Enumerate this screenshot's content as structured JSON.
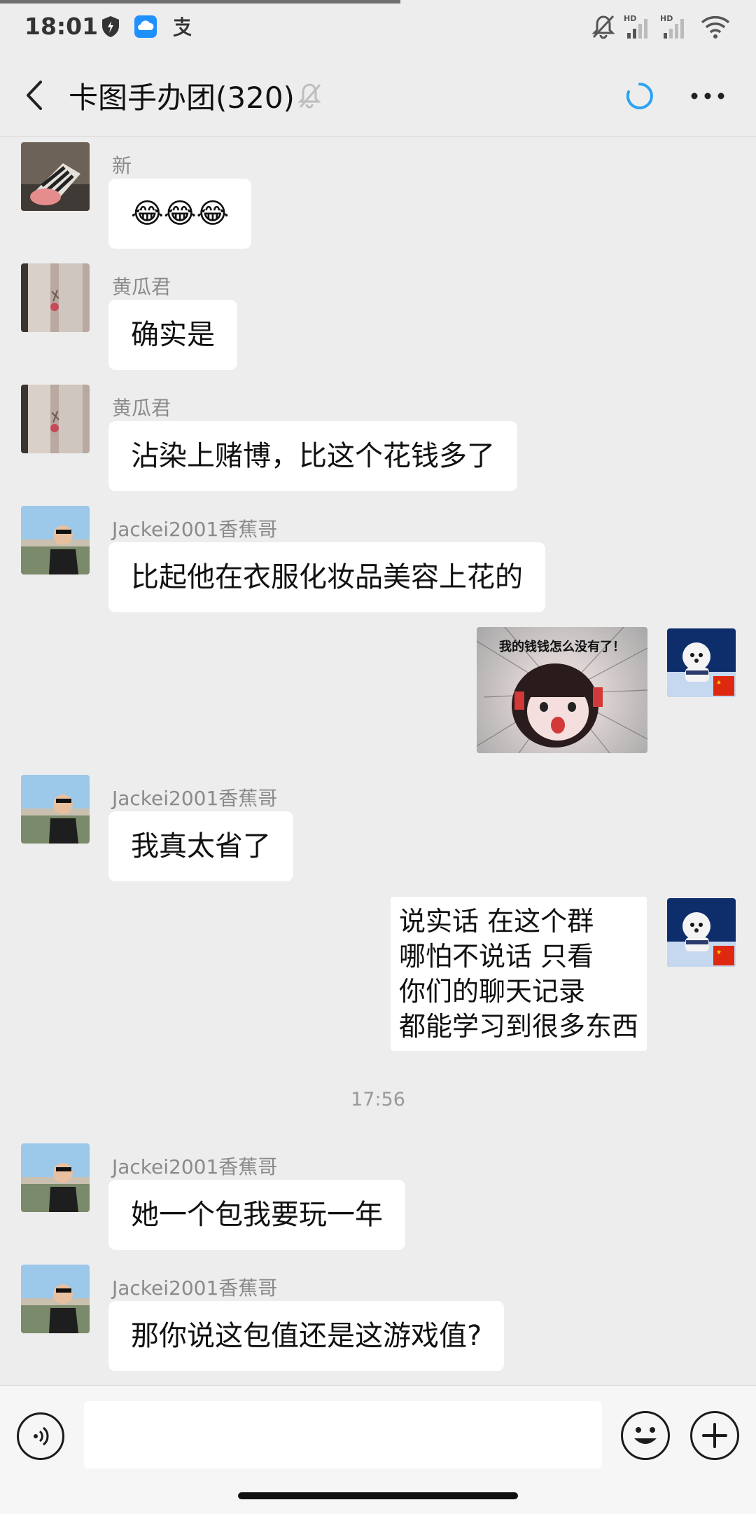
{
  "status_bar": {
    "time": "18:01",
    "icons": [
      "shield-icon",
      "cloud-icon",
      "alipay-icon",
      "mute-bell-icon",
      "signal-hd-icon",
      "signal-hd-icon",
      "wifi-icon"
    ],
    "hd_label": "HD"
  },
  "header": {
    "title": "卡图手办团(320)",
    "icons": [
      "back-icon",
      "bell-muted-icon",
      "loading-icon",
      "more-icon"
    ]
  },
  "messages": [
    {
      "sender": "新",
      "text": "😂😂😂",
      "side": "left"
    },
    {
      "sender": "黄瓜君",
      "text": "确实是",
      "side": "left"
    },
    {
      "sender": "黄瓜君",
      "text": "沾染上赌博，比这个花钱多了",
      "side": "left"
    },
    {
      "sender": "Jackei2001香蕉哥",
      "text": "比起他在衣服化妆品美容上花的",
      "side": "left"
    },
    {
      "sender": "",
      "sticker_text": "我的钱钱怎么没有了！",
      "side": "right"
    },
    {
      "sender": "Jackei2001香蕉哥",
      "text": "我真太省了",
      "side": "left"
    },
    {
      "sender": "",
      "lines": [
        "说实话  在这个群",
        "哪怕不说话  只看",
        "你们的聊天记录",
        "都能学习到很多东西"
      ],
      "side": "right"
    },
    {
      "sender": "Jackei2001香蕉哥",
      "text": "她一个包我要玩一年",
      "side": "left"
    },
    {
      "sender": "Jackei2001香蕉哥",
      "text": "那你说这包值还是这游戏值?",
      "side": "left"
    }
  ],
  "time_divider": "17:56",
  "input_bar": {
    "placeholder": "",
    "icons": [
      "voice-icon",
      "emoji-icon",
      "plus-icon"
    ]
  },
  "colors": {
    "background": "#ededed",
    "bubble": "#ffffff",
    "sync_accent": "#2ba3f0",
    "flag_red": "#de2910"
  }
}
